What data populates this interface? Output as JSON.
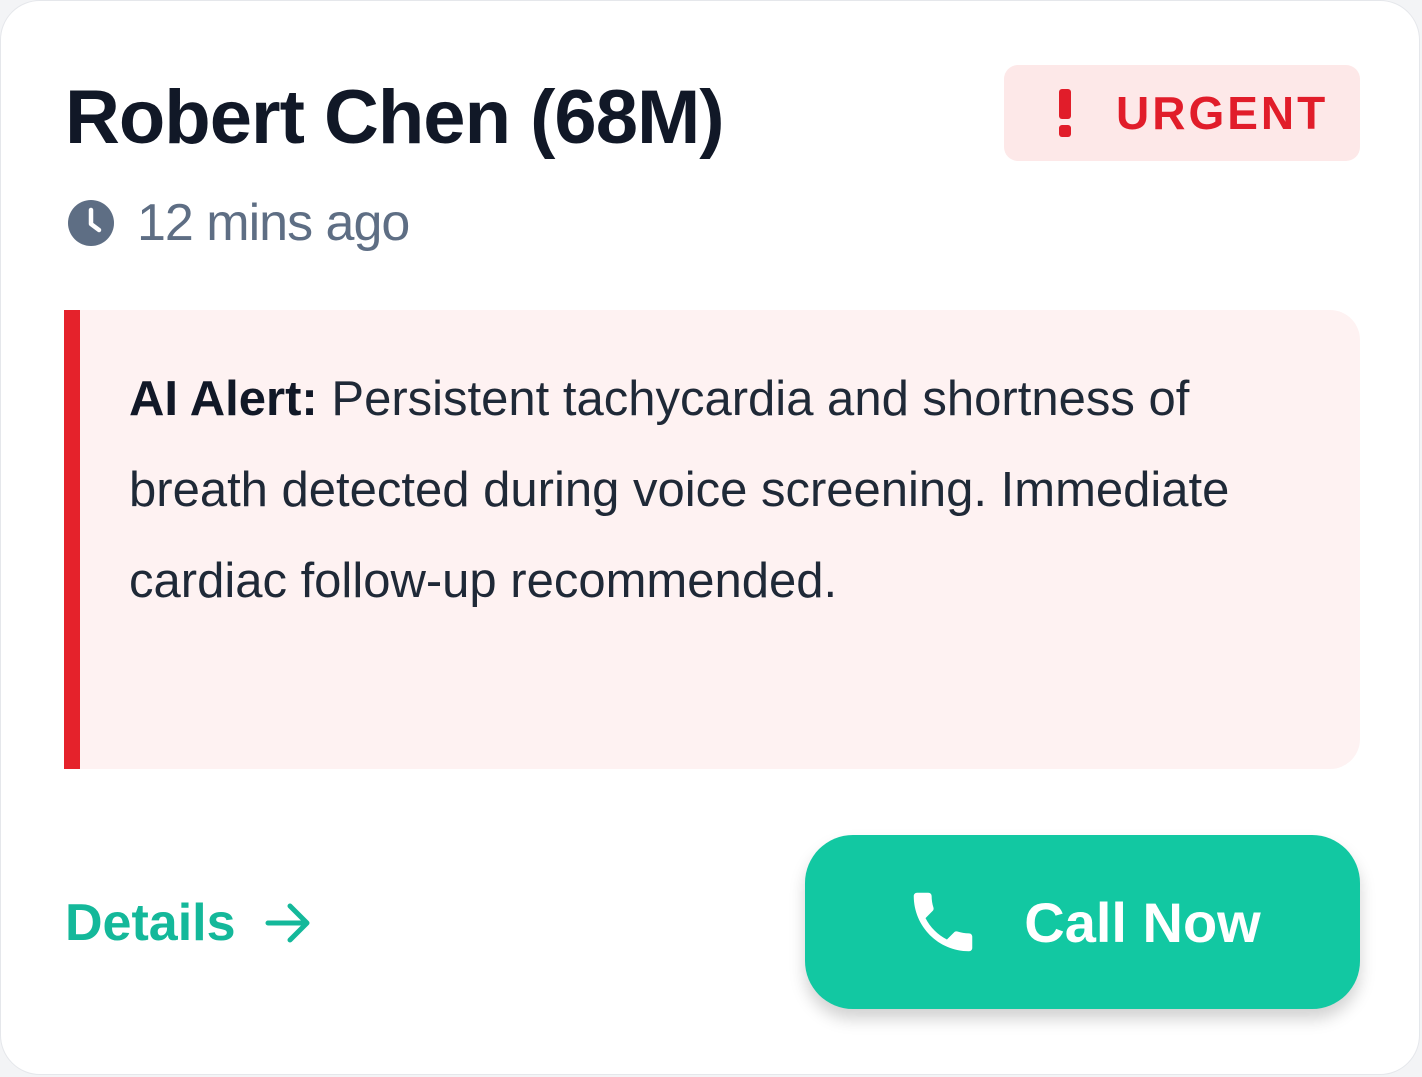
{
  "patient": {
    "name": "Robert Chen (68M)",
    "time_ago": "12 mins ago"
  },
  "status_badge": {
    "label": "URGENT",
    "icon": "exclamation-icon",
    "color": "#e11d2a",
    "background": "#fde8e8"
  },
  "alert": {
    "label": "AI Alert:",
    "message": "Persistent tachycardia and shortness of breath detected during voice screening. Immediate cardiac follow-up recommended.",
    "accent_color": "#e5222b"
  },
  "actions": {
    "details_label": "Details",
    "details_icon": "arrow-right-icon",
    "call_label": "Call Now",
    "call_icon": "phone-icon",
    "accent_color": "#12c8a2"
  }
}
